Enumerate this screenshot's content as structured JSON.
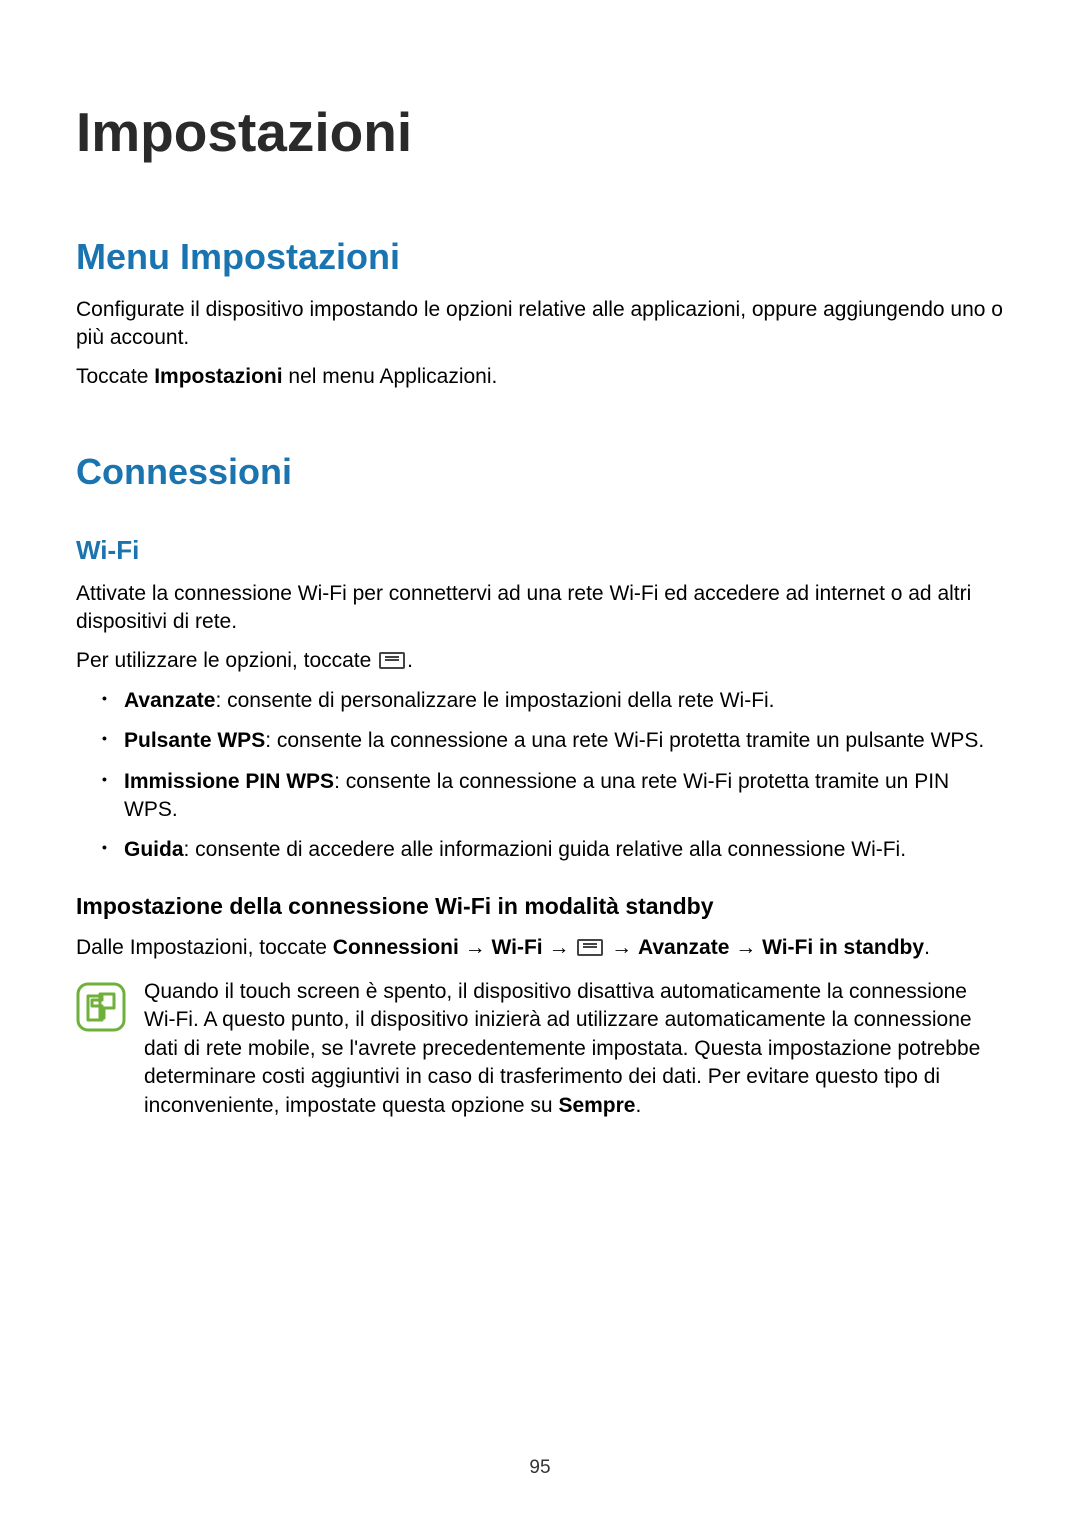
{
  "page_title": "Impostazioni",
  "section1": {
    "heading": "Menu Impostazioni",
    "para1": "Configurate il dispositivo impostando le opzioni relative alle applicazioni, oppure aggiungendo uno o più account.",
    "para2_pre": "Toccate ",
    "para2_bold": "Impostazioni",
    "para2_post": " nel menu Applicazioni."
  },
  "section2": {
    "heading": "Connessioni",
    "sub_heading": "Wi-Fi",
    "para1": "Attivate la connessione Wi-Fi per connettervi ad una rete Wi-Fi ed accedere ad internet o ad altri dispositivi di rete.",
    "para2_pre": "Per utilizzare le opzioni, toccate ",
    "para2_post": ".",
    "bullets": [
      {
        "bold": "Avanzate",
        "rest": ": consente di personalizzare le impostazioni della rete Wi-Fi."
      },
      {
        "bold": "Pulsante WPS",
        "rest": ": consente la connessione a una rete Wi-Fi protetta tramite un pulsante WPS."
      },
      {
        "bold": "Immissione PIN WPS",
        "rest": ": consente la connessione a una rete Wi-Fi protetta tramite un PIN WPS."
      },
      {
        "bold": "Guida",
        "rest": ": consente di accedere alle informazioni guida relative alla connessione Wi-Fi."
      }
    ],
    "h4": "Impostazione della connessione Wi-Fi in modalità standby",
    "nav_pre": "Dalle Impostazioni, toccate ",
    "nav_b1": "Connessioni",
    "nav_arrow": " → ",
    "nav_b2": "Wi-Fi",
    "nav_b3": "Avanzate",
    "nav_b4": "Wi-Fi in standby",
    "nav_post": ".",
    "note_pre": "Quando il touch screen è spento, il dispositivo disattiva automaticamente la connessione Wi-Fi. A questo punto, il dispositivo inizierà ad utilizzare automaticamente la connessione dati di rete mobile, se l'avrete precedentemente impostata. Questa impostazione potrebbe determinare costi aggiuntivi in caso di trasferimento dei dati. Per evitare questo tipo di inconveniente, impostate questa opzione su ",
    "note_bold": "Sempre",
    "note_post": "."
  },
  "page_number": "95"
}
